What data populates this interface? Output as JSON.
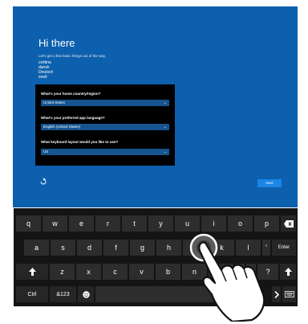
{
  "setup": {
    "title": "Hi there",
    "subtitle": "Let's get a few basic things out of the way.",
    "languages": [
      "ceština",
      "dansk",
      "Deutsch",
      "eesti"
    ],
    "fields": [
      {
        "question": "What's your home country/region?",
        "value": "United States"
      },
      {
        "question": "What's your preferred app language?",
        "value": "English (United States)"
      },
      {
        "question": "What keyboard layout would you like to use?",
        "value": "US"
      }
    ],
    "next_label": "Next"
  },
  "keyboard": {
    "row1": [
      "q",
      "w",
      "e",
      "r",
      "t",
      "y",
      "u",
      "i",
      "o",
      "p"
    ],
    "row2": [
      "a",
      "s",
      "d",
      "f",
      "g",
      "h",
      "j",
      "k",
      "l",
      "'"
    ],
    "row3": [
      "z",
      "x",
      "c",
      "v",
      "b",
      "n",
      "m",
      ",",
      ".",
      "?"
    ],
    "enter_label": "Enter",
    "ctrl_label": "Ctrl",
    "symbols_label": "&123"
  },
  "colors": {
    "screen_bg": "#0d60ad",
    "form_bg": "#000000",
    "select_bg": "#15548f",
    "next_button": "#1a86e5",
    "keyboard_bg": "#141414",
    "key_bg": "#2d2d2d"
  },
  "icons": {
    "accessibility": "ease-of-access-icon",
    "backspace": "backspace-icon",
    "shift": "shift-icon",
    "emoji": "emoji-icon",
    "arrow_right": "arrow-right-icon",
    "keyboard": "keyboard-icon",
    "hand": "tap-hand-icon"
  }
}
